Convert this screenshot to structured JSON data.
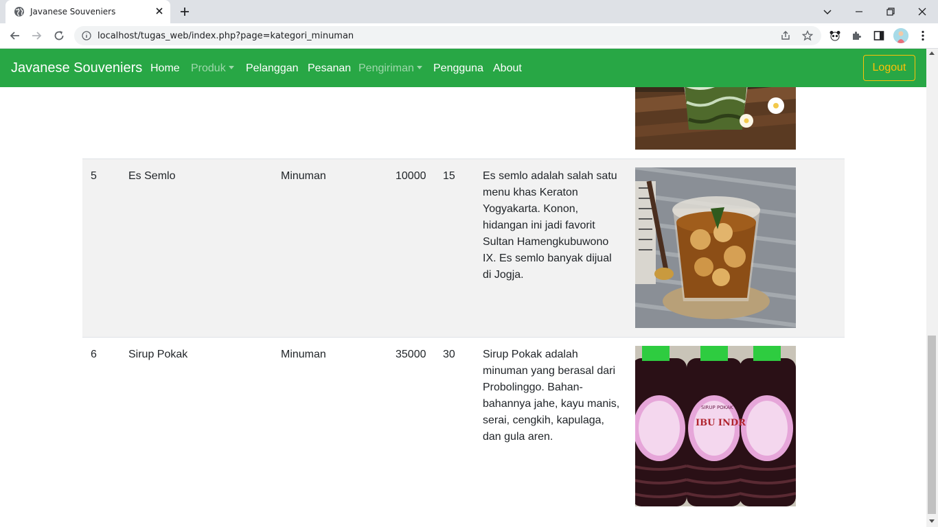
{
  "browser": {
    "tab_title": "Javanese Souveniers",
    "url": "localhost/tugas_web/index.php?page=kategori_minuman"
  },
  "navbar": {
    "brand": "Javanese Souveniers",
    "links": [
      {
        "label": "Home",
        "dropdown": false,
        "muted": false
      },
      {
        "label": "Produk",
        "dropdown": true,
        "muted": true
      },
      {
        "label": "Pelanggan",
        "dropdown": false,
        "muted": false
      },
      {
        "label": "Pesanan",
        "dropdown": false,
        "muted": false
      },
      {
        "label": "Pengiriman",
        "dropdown": true,
        "muted": true
      },
      {
        "label": "Pengguna",
        "dropdown": false,
        "muted": false
      },
      {
        "label": "About",
        "dropdown": false,
        "muted": false
      }
    ],
    "logout": "Logout",
    "colors": {
      "bar": "#28a745",
      "logout": "#ffc107"
    }
  },
  "table": {
    "rows": [
      {
        "no": "5",
        "name": "Es Semlo",
        "category": "Minuman",
        "price": "10000",
        "stock": "15",
        "description": [
          "Es semlo adalah salah satu",
          "menu khas Keraton",
          "Yogyakarta. Konon,",
          "hidangan ini jadi favorit",
          "Sultan Hamengkubuwono",
          "IX. Es semlo banyak dijual",
          "di Jogja."
        ],
        "image": "es-semlo-photo"
      },
      {
        "no": "6",
        "name": "Sirup Pokak",
        "category": "Minuman",
        "price": "35000",
        "stock": "30",
        "description": [
          "Sirup Pokak adalah",
          "minuman yang berasal dari",
          "Probolinggo. Bahan-",
          "bahannya jahe, kayu manis,",
          "serai, cengkih, kapulaga,",
          "dan gula aren."
        ],
        "image": "sirup-pokak-photo",
        "label_text": "SIRUP POKAK",
        "brand_text": "IBU INDR"
      }
    ],
    "partial_previous_image": "es-dawet-photo"
  }
}
